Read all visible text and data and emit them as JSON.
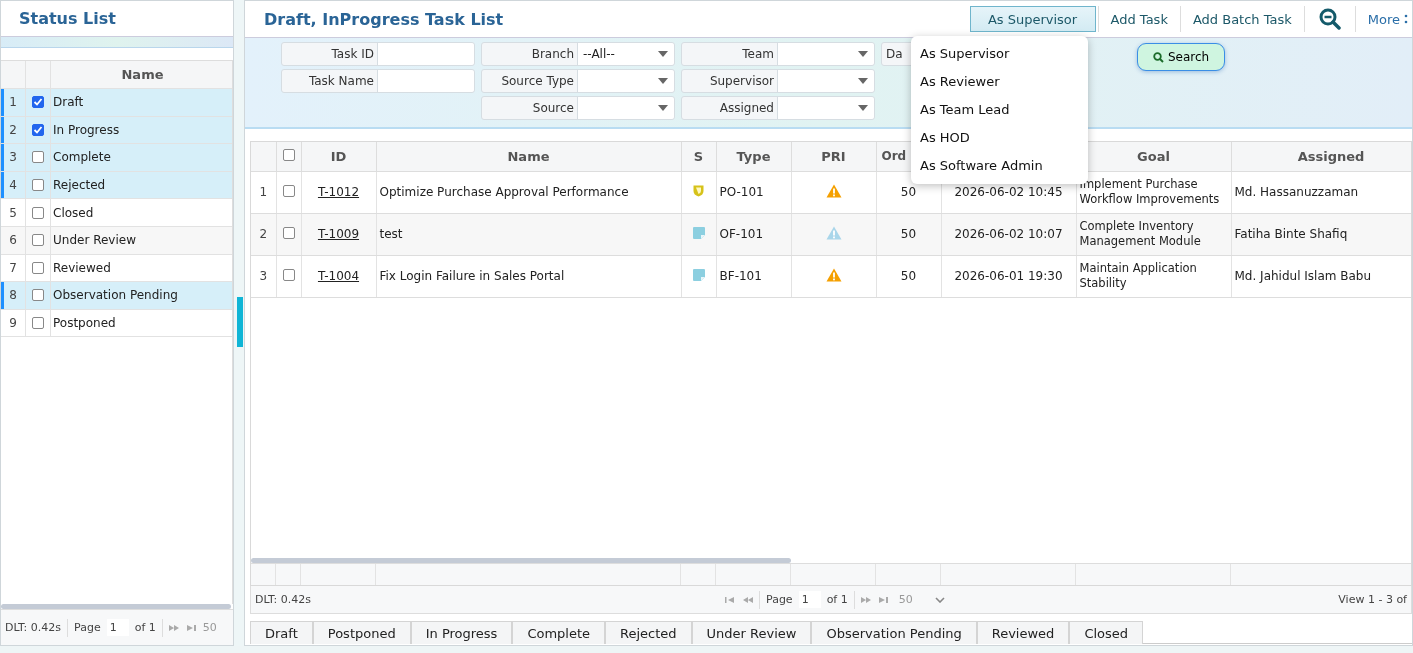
{
  "status_panel": {
    "title": "Status List",
    "column": "Name",
    "rows": [
      {
        "number": "1",
        "name": "Draft",
        "checked": true,
        "selected": true
      },
      {
        "number": "2",
        "name": "In Progress",
        "checked": true,
        "selected": true
      },
      {
        "number": "3",
        "name": "Complete",
        "checked": false,
        "selected": true
      },
      {
        "number": "4",
        "name": "Rejected",
        "checked": false,
        "selected": true
      },
      {
        "number": "5",
        "name": "Closed",
        "checked": false,
        "selected": false
      },
      {
        "number": "6",
        "name": "Under Review",
        "checked": false,
        "selected": false
      },
      {
        "number": "7",
        "name": "Reviewed",
        "checked": false,
        "selected": false
      },
      {
        "number": "8",
        "name": "Observation Pending",
        "checked": false,
        "selected": true
      },
      {
        "number": "9",
        "name": "Postponed",
        "checked": false,
        "selected": false
      }
    ],
    "pager": {
      "timing": "DLT: 0.42s",
      "page_label": "Page",
      "page": "1",
      "of": "of 1",
      "page_size": "50"
    }
  },
  "main": {
    "title": "Draft, InProgress Task List",
    "toolbar": [
      {
        "kind": "dropdown",
        "label": "As Supervisor",
        "expanded": true
      },
      {
        "kind": "button",
        "label": "Add Task"
      },
      {
        "kind": "button",
        "label": "Add Batch Task"
      },
      {
        "kind": "zoom"
      },
      {
        "kind": "more",
        "label": "More"
      }
    ],
    "menu": [
      "As Supervisor",
      "As Reviewer",
      "As Team Lead",
      "As HOD",
      "As Software Admin"
    ],
    "filter_columns": [
      [
        {
          "label": "Task ID",
          "kind": "text"
        },
        {
          "label": "Task Name",
          "kind": "text"
        }
      ],
      [
        {
          "label": "Branch",
          "kind": "select",
          "value": "--All--"
        },
        {
          "label": "Source Type",
          "kind": "select"
        },
        {
          "label": "Source",
          "kind": "select"
        }
      ],
      [
        {
          "label": "Team",
          "kind": "select"
        },
        {
          "label": "Supervisor",
          "kind": "select"
        },
        {
          "label": "Assigned",
          "kind": "select"
        }
      ],
      [
        {
          "label": "Da"
        }
      ]
    ],
    "search_button": "Search",
    "table": {
      "header_checked": false,
      "columns": [
        {
          "label": "ID"
        },
        {
          "label": "Name"
        },
        {
          "label": "S"
        },
        {
          "label": "Type"
        },
        {
          "label": "PRI"
        },
        {
          "label": "Ord"
        },
        {},
        {
          "label": "Goal"
        },
        {
          "label": "Assigned"
        }
      ],
      "rows": [
        {
          "number": "1",
          "checked": false,
          "id": "T-1012",
          "name": "Optimize Purchase Approval Performance",
          "status": {
            "kind": "shield"
          },
          "type": "PO-101",
          "priority": {
            "color": "#f5a000"
          },
          "order": "50",
          "deadline": "2026-06-02 10:45",
          "goal": "Implement Purchase Workflow Improvements",
          "assigned": "Md. Hassanuzzaman"
        },
        {
          "number": "2",
          "checked": false,
          "id": "T-1009",
          "name": "test",
          "status": {
            "kind": "note"
          },
          "type": "OF-101",
          "priority": {
            "color": "#a9d6ea"
          },
          "order": "50",
          "deadline": "2026-06-02 10:07",
          "goal": "Complete Inventory Management Module",
          "assigned": "Fatiha Binte Shafiq"
        },
        {
          "number": "3",
          "checked": false,
          "id": "T-1004",
          "name": "Fix Login Failure in Sales Portal",
          "status": {
            "kind": "note"
          },
          "type": "BF-101",
          "priority": {
            "color": "#f5a000"
          },
          "order": "50",
          "deadline": "2026-06-01 19:30",
          "goal": "Maintain Application Stability",
          "assigned": "Md. Jahidul Islam Babu"
        }
      ]
    },
    "pager": {
      "timing": "DLT: 0.42s",
      "page_label": "Page",
      "page": "1",
      "of": "of 1",
      "page_size": "50",
      "view": "View 1 - 3 of"
    },
    "tabs": [
      {
        "label": "Draft",
        "selected": false
      },
      {
        "label": "Postponed",
        "selected": false
      },
      {
        "label": "In Progress",
        "selected": false
      },
      {
        "label": "Complete",
        "selected": false
      },
      {
        "label": "Rejected",
        "selected": false
      },
      {
        "label": "Under Review",
        "selected": false
      },
      {
        "label": "Observation Pending",
        "selected": false
      },
      {
        "label": "Reviewed",
        "selected": false
      },
      {
        "label": "Closed",
        "selected": false
      }
    ]
  }
}
